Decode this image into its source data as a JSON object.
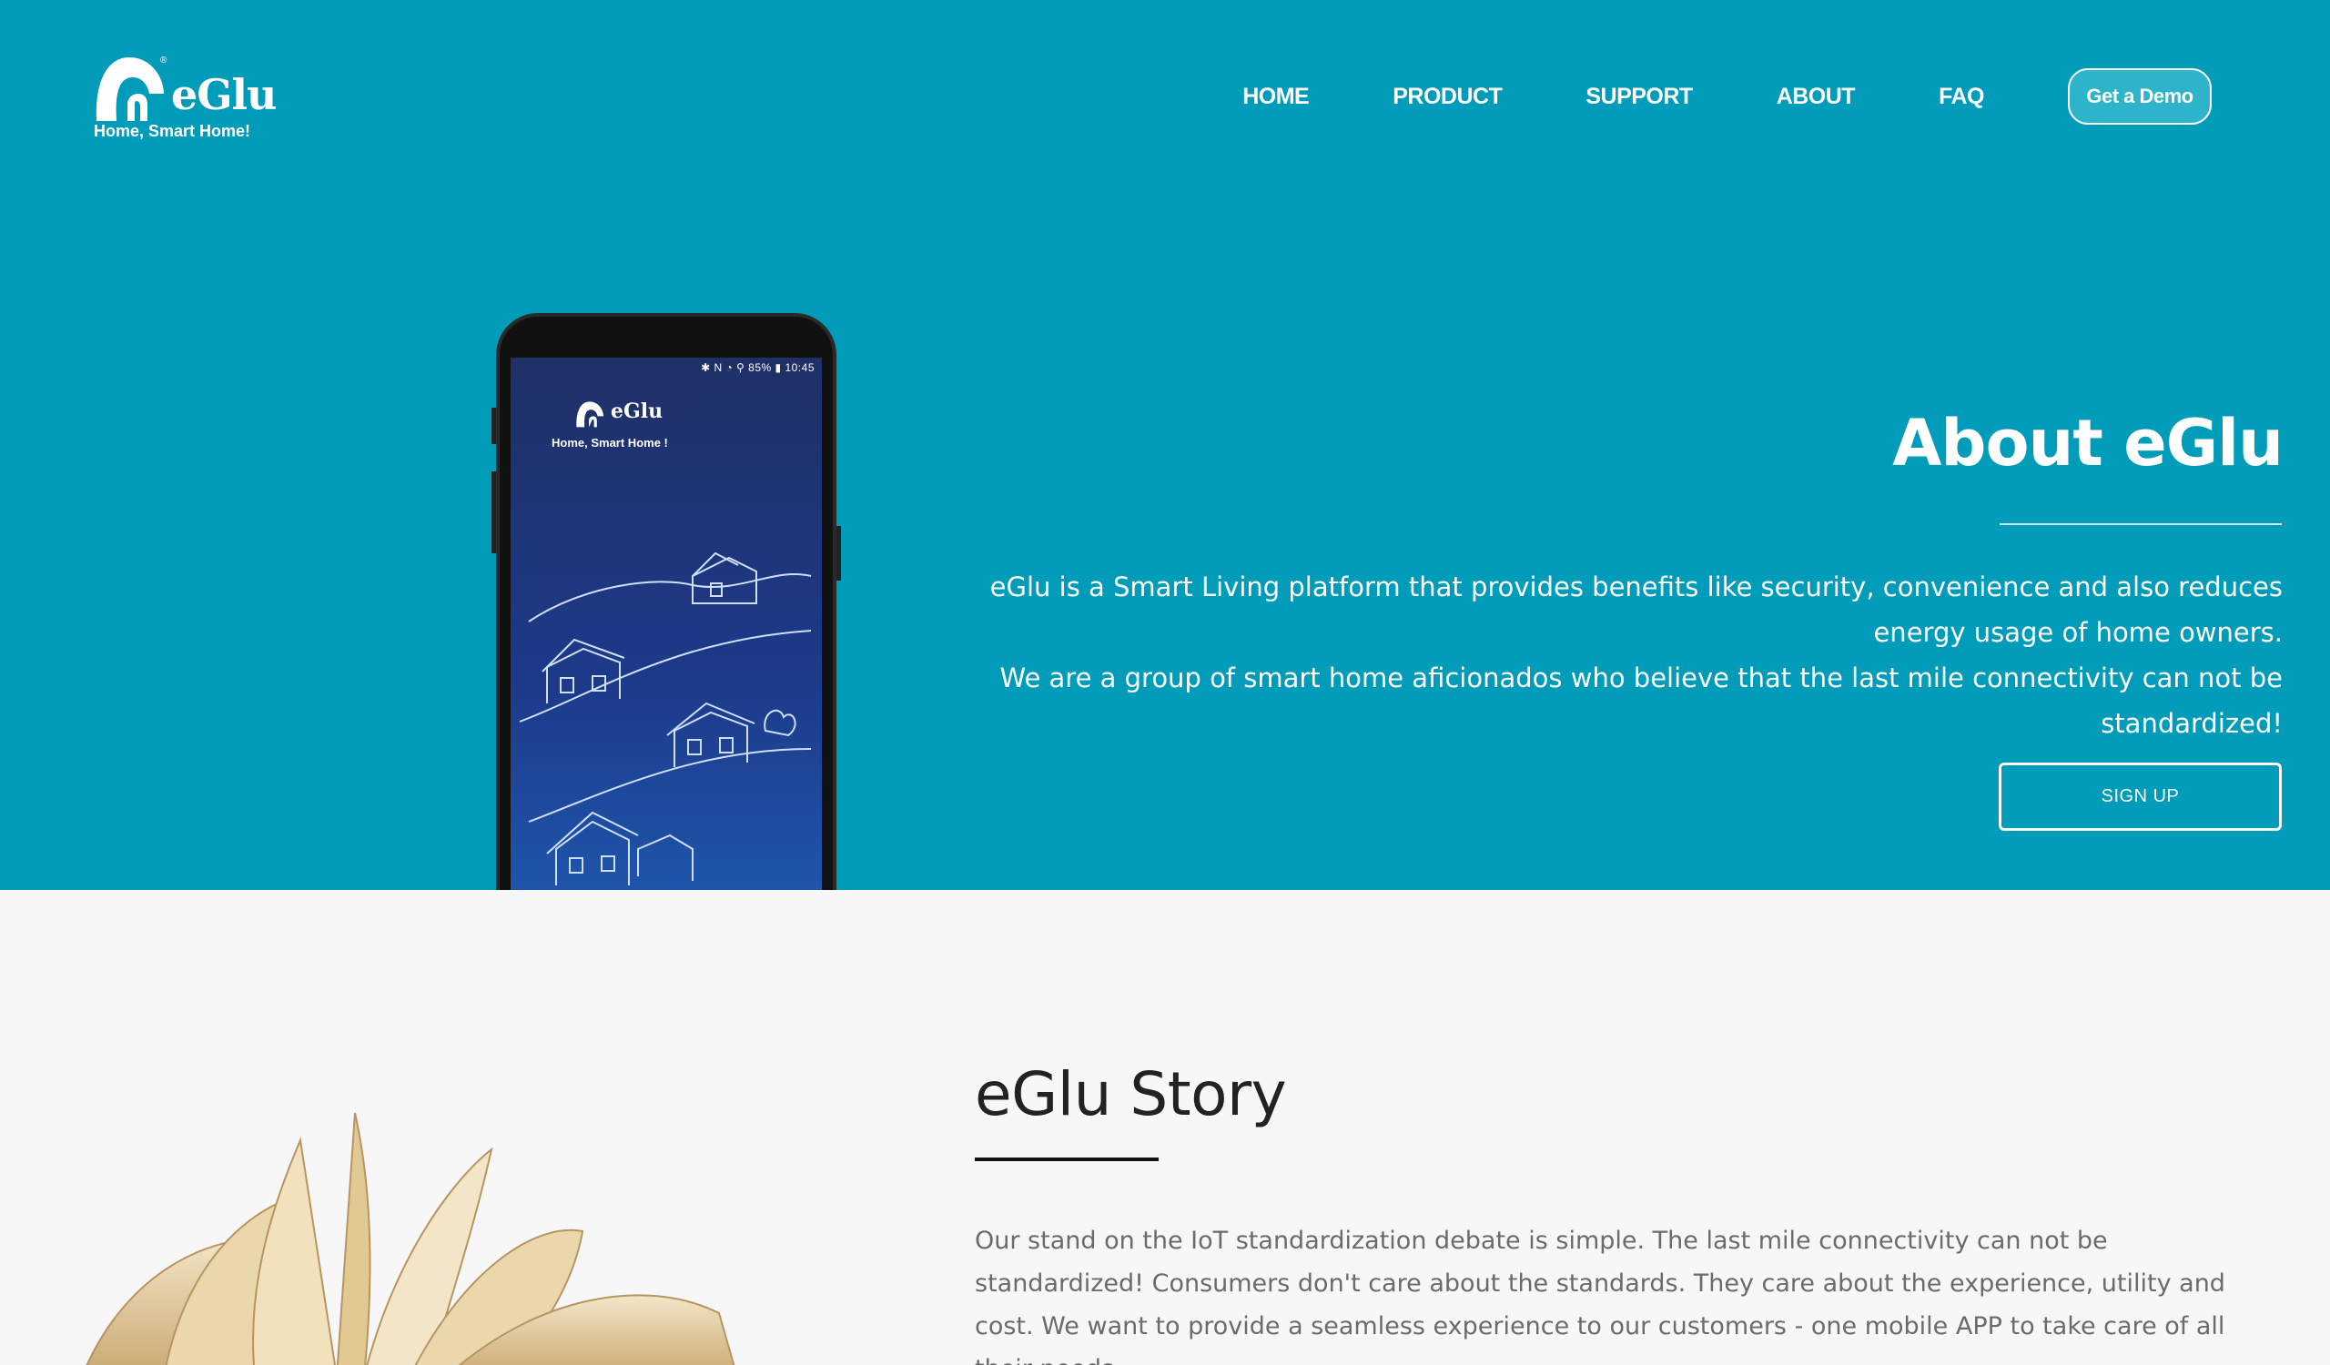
{
  "header": {
    "logo_text": "eGlu",
    "logo_reg": "®",
    "tagline": "Home, Smart Home!",
    "nav": [
      {
        "label": "HOME"
      },
      {
        "label": "PRODUCT"
      },
      {
        "label": "SUPPORT"
      },
      {
        "label": "ABOUT"
      },
      {
        "label": "FAQ"
      }
    ],
    "demo_button": "Get a Demo"
  },
  "phone": {
    "status": "✱ N ◔ ⚲ 85% ▮ 10:45",
    "app_name": "eGlu",
    "app_tagline": "Home, Smart Home !"
  },
  "about": {
    "title": "About eGlu",
    "line1": "eGlu is a Smart Living platform that provides benefits like security, convenience and also reduces energy usage of home owners.",
    "line2": "We are a group of smart home aficionados who believe that the last mile connectivity can not be standardized!",
    "signup_button": "SIGN UP"
  },
  "story": {
    "title": "eGlu Story",
    "text": "Our stand on the IoT standardization debate is simple. The last mile connectivity can not be standardized! Consumers don't care about the standards. They care about the experience, utility and cost. We want to provide a seamless experience to our customers - one mobile APP to take care of all their needs."
  },
  "colors": {
    "hero_bg": "#009cba",
    "page_bg": "#f7f7f7",
    "demo_button_bg": "#2db4ca"
  }
}
